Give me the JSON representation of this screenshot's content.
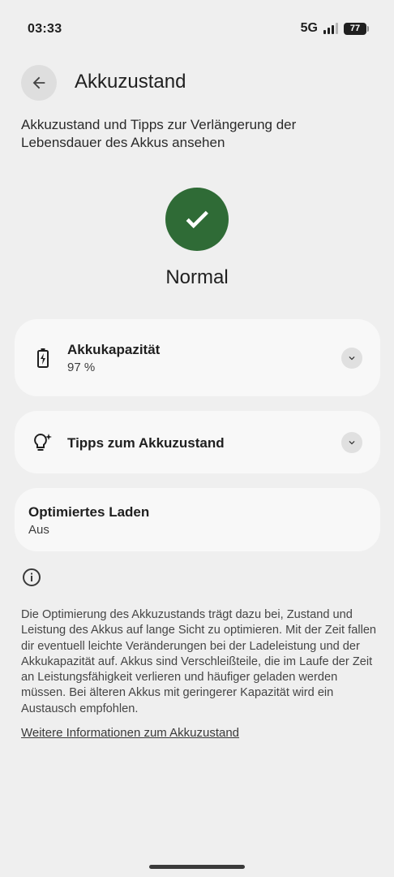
{
  "status_bar": {
    "time": "03:33",
    "network": "5G",
    "battery_level": "77"
  },
  "app_bar": {
    "title": "Akkuzustand",
    "back_icon": "arrow-back-icon"
  },
  "subtitle": "Akkuzustand und Tipps zur Verlängerung der Lebensdauer des Akkus ansehen",
  "status": {
    "label": "Normal",
    "icon": "check-icon",
    "color": "#2f6b36"
  },
  "cards": {
    "capacity": {
      "title": "Akkukapazität",
      "value": "97 %",
      "icon": "battery-charging-icon"
    },
    "tips": {
      "title": "Tipps zum Akkuzustand",
      "icon": "lightbulb-sparkle-icon"
    },
    "optimized_charging": {
      "title": "Optimiertes Laden",
      "value": "Aus"
    }
  },
  "info": {
    "icon": "info-icon",
    "text": "Die Optimierung des Akkuzustands trägt dazu bei, Zustand und Leistung des Akkus auf lange Sicht zu optimieren. Mit der Zeit fallen dir eventuell leichte Veränderungen bei der Ladeleistung und der Akkukapazität auf. Akkus sind Verschleißteile, die im Laufe der Zeit an Leistungsfähigkeit verlieren und häufiger geladen werden müssen. Bei älteren Akkus mit geringerer Kapazität wird ein Austausch empfohlen.",
    "link": "Weitere Informationen zum Akkuzustand"
  }
}
